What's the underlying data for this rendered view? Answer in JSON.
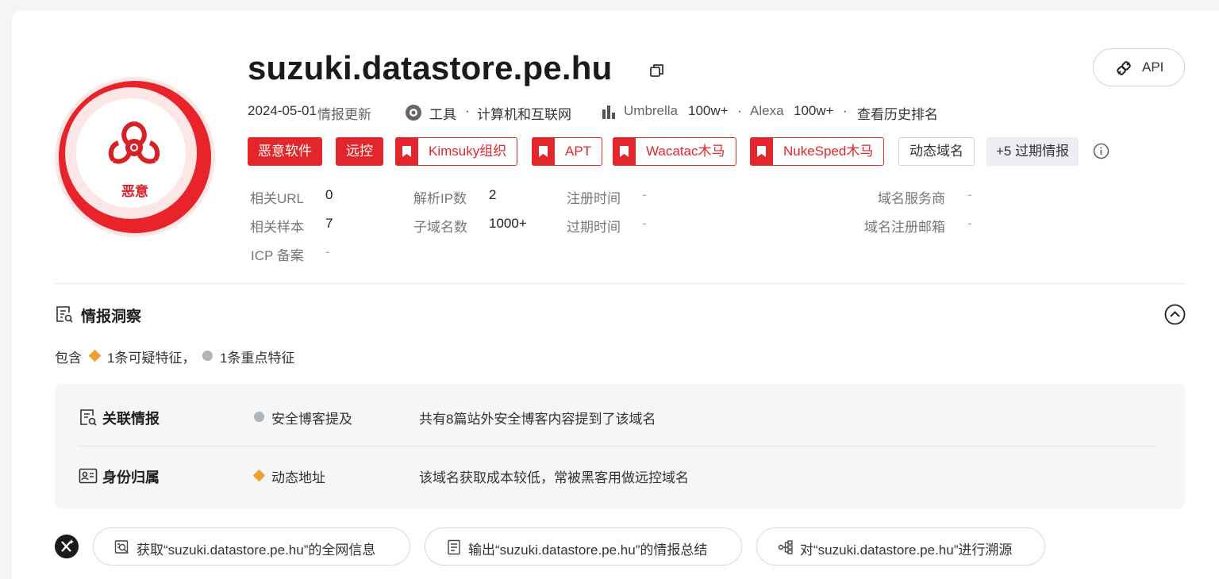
{
  "verdict": {
    "label": "恶意",
    "color": "#e2262c"
  },
  "domain": {
    "name": "suzuki.datastore.pe.hu"
  },
  "api_button": {
    "label": "API"
  },
  "meta": {
    "updated_date": "2024-05-01",
    "updated_label": "情报更新",
    "category": "工具",
    "subcategory": "计算机和互联网",
    "umbrella_label": "Umbrella",
    "umbrella_rank": "100w+",
    "alexa_label": "Alexa",
    "alexa_rank": "100w+",
    "history_link": "查看历史排名"
  },
  "tags": {
    "malware": "恶意软件",
    "remote": "远控",
    "kimsuky": "Kimsuky组织",
    "apt": "APT",
    "wacatac": "Wacatac木马",
    "nukesped": "NukeSped木马",
    "dynamic_domain": "动态域名",
    "more_expired": "+5 过期情报"
  },
  "fields": {
    "related_url_label": "相关URL",
    "related_url_value": "0",
    "resolved_ip_label": "解析IP数",
    "resolved_ip_value": "2",
    "reg_time_label": "注册时间",
    "reg_time_value": "-",
    "registrar_label": "域名服务商",
    "registrar_value": "-",
    "related_sample_label": "相关样本",
    "related_sample_value": "7",
    "subdomain_label": "子域名数",
    "subdomain_value": "1000+",
    "expire_label": "过期时间",
    "expire_value": "-",
    "reg_email_label": "域名注册邮箱",
    "reg_email_value": "-",
    "icp_label": "ICP 备案",
    "icp_value": "-"
  },
  "insight": {
    "title": "情报洞察",
    "summary_prefix": "包含",
    "summary_suspicious": "1条可疑特征，",
    "summary_key": "1条重点特征",
    "rows": [
      {
        "title": "关联情报",
        "feature": "安全博客提及",
        "desc": "共有8篇站外安全博客内容提到了该域名"
      },
      {
        "title": "身份归属",
        "feature": "动态地址",
        "desc": "该域名获取成本较低，常被黑客用做远控域名"
      }
    ]
  },
  "ai_actions": [
    {
      "label": "获取“suzuki.datastore.pe.hu”的全网信息"
    },
    {
      "label": "输出“suzuki.datastore.pe.hu”的情报总结"
    },
    {
      "label": "对“suzuki.datastore.pe.hu”进行溯源"
    }
  ]
}
